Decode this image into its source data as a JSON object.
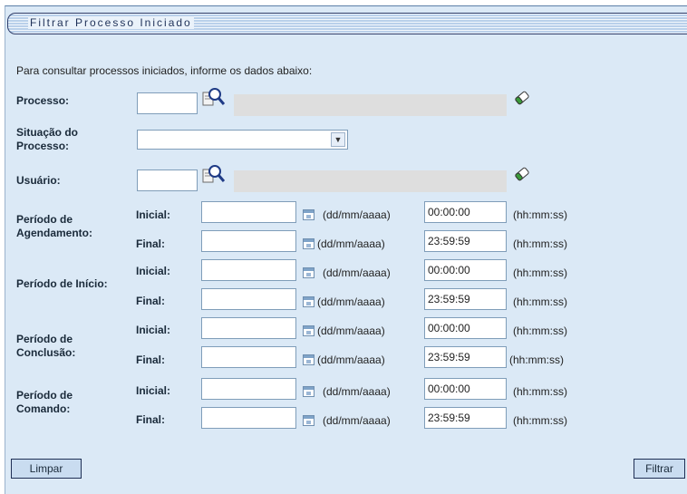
{
  "title": "Filtrar Processo Iniciado",
  "intro": "Para consultar processos iniciados, informe os dados abaixo:",
  "fields": {
    "processo_label": "Processo:",
    "situacao_label_line1": "Situação do",
    "situacao_label_line2": "Processo:",
    "usuario_label": "Usuário:"
  },
  "periods": {
    "agendamento": {
      "label1": "Período de",
      "label2": "Agendamento:",
      "start_time": "00:00:00",
      "end_time": "23:59:59"
    },
    "inicio": {
      "label1": "Período de Início:",
      "start_time": "00:00:00",
      "end_time": "23:59:59"
    },
    "conclusao": {
      "label1": "Período de",
      "label2": "Conclusão:",
      "start_time": "00:00:00",
      "end_time": "23:59:59"
    },
    "comando": {
      "label1": "Período de",
      "label2": "Comando:",
      "start_time": "00:00:00",
      "end_time": "23:59:59"
    }
  },
  "labels": {
    "inicial": "Inicial:",
    "final": "Final:",
    "date_format": "(dd/mm/aaaa)",
    "time_format": "(hh:mm:ss)"
  },
  "buttons": {
    "limpar": "Limpar",
    "filtrar": "Filtrar"
  },
  "icons": {
    "search": "magnifier-icon",
    "clear": "eraser-icon",
    "calendar": "calendar-icon",
    "dropdown": "chevron-down-icon"
  }
}
